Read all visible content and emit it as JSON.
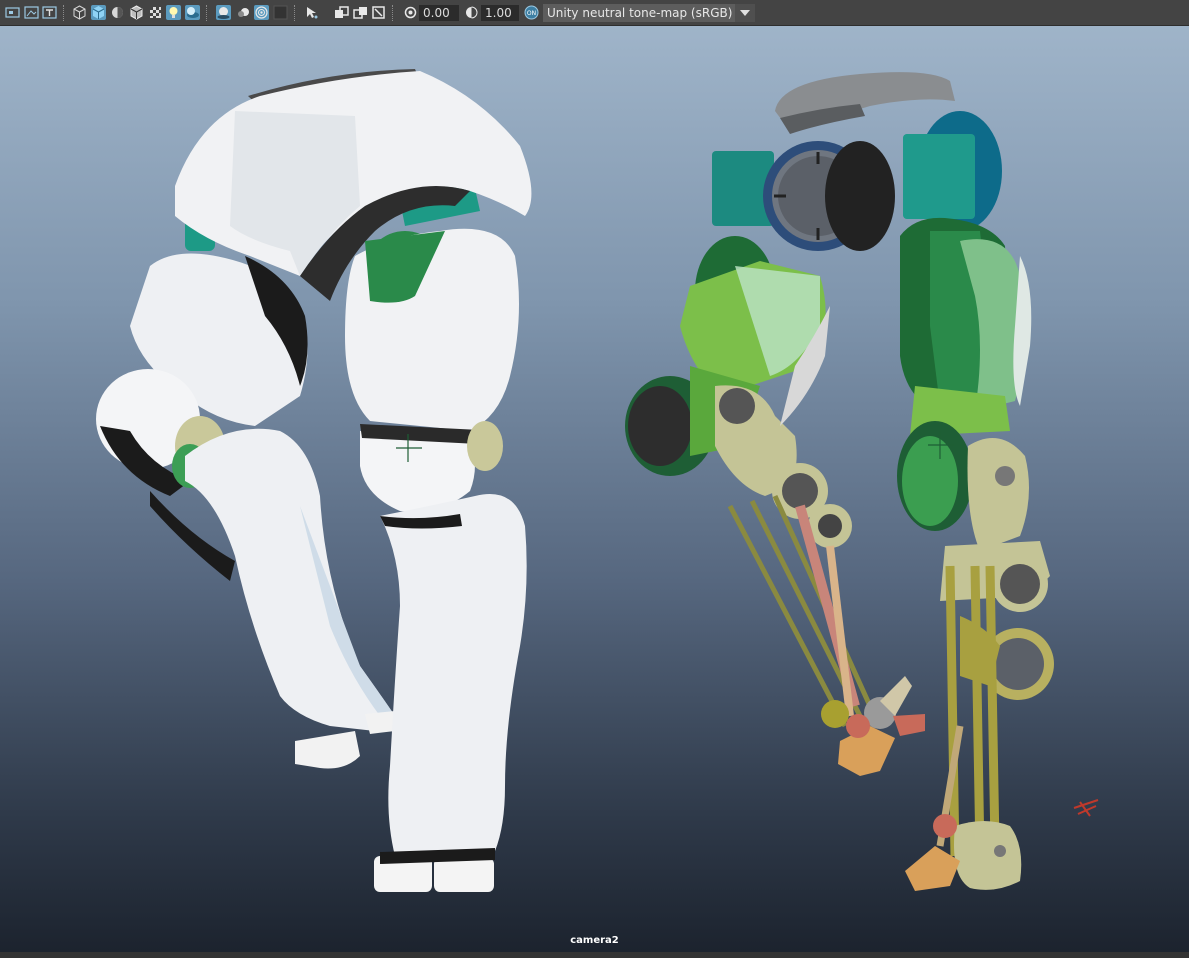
{
  "toolbar": {
    "exposure_value": "0.00",
    "gamma_value": "1.00",
    "colorspace_badge": "ON",
    "color_management_view": "Unity neutral tone-map (sRGB)",
    "icons": [
      "select-camera-icon",
      "camera-attributes-icon",
      "image-plane-icon",
      "wireframe-icon",
      "smooth-shade-icon",
      "use-default-material-icon",
      "wireframe-on-shaded-icon",
      "textured-icon",
      "use-all-lights-icon",
      "shadows-icon",
      "screen-space-ao-icon",
      "motion-blur-icon",
      "anti-aliasing-icon",
      "depth-of-field-icon",
      "isolate-select-icon",
      "xray-icon",
      "xray-active-components-icon",
      "xray-joints-icon",
      "backface-culling-icon",
      "exposure-icon",
      "gamma-icon",
      "color-management-icon"
    ],
    "accent_color": "#5b9bbf"
  },
  "viewport": {
    "camera_name": "camera2",
    "objects": [
      "white-armored-legs",
      "mechanical-leg-rig"
    ]
  }
}
